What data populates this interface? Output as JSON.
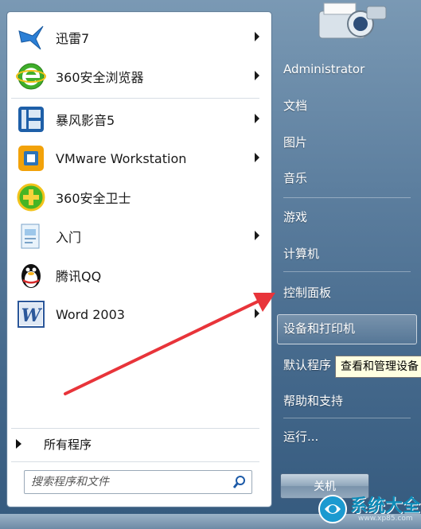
{
  "start_menu": {
    "pinned_programs": [
      {
        "label": "迅雷7",
        "icon": "thunder-bird-icon",
        "has_submenu": true
      },
      {
        "label": "360安全浏览器",
        "icon": "360-browser-icon",
        "has_submenu": true
      },
      {
        "label": "暴风影音5",
        "icon": "baofeng-player-icon",
        "has_submenu": true
      },
      {
        "label": "VMware Workstation",
        "icon": "vmware-icon",
        "has_submenu": true
      },
      {
        "label": "360安全卫士",
        "icon": "360-safeguard-icon",
        "has_submenu": false
      },
      {
        "label": "入门",
        "icon": "getting-started-icon",
        "has_submenu": true
      },
      {
        "label": "腾讯QQ",
        "icon": "qq-penguin-icon",
        "has_submenu": false
      },
      {
        "label": "Word 2003",
        "icon": "word-icon",
        "has_submenu": true
      }
    ],
    "all_programs_label": "所有程序",
    "search": {
      "placeholder": "搜索程序和文件"
    },
    "right_items": {
      "user": "Administrator",
      "documents": "文档",
      "pictures": "图片",
      "music": "音乐",
      "games": "游戏",
      "computer": "计算机",
      "control_panel": "控制面板",
      "devices_printers": "设备和打印机",
      "default_programs": "默认程序",
      "help_support": "帮助和支持",
      "run": "运行..."
    },
    "tooltip": "查看和管理设备",
    "shutdown_label": "关机"
  },
  "watermark": {
    "text": "系统大全",
    "url": "www.xp85.com"
  },
  "colors": {
    "annotation_arrow": "#e8343a",
    "tooltip_bg": "#ffffe1"
  }
}
